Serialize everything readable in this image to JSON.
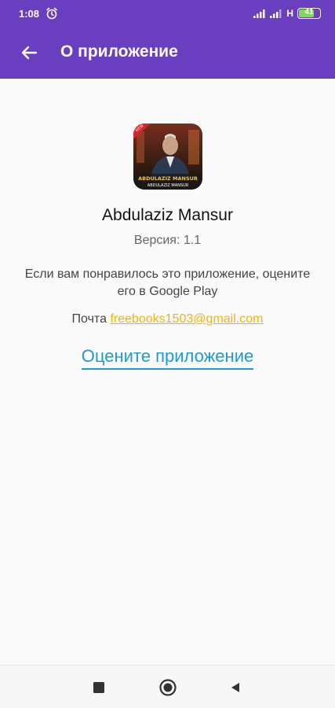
{
  "status_bar": {
    "time": "1:08",
    "network_type": "H",
    "battery_level": "41",
    "icons": [
      "alarm-icon",
      "signal-icon",
      "signal-icon",
      "battery-icon"
    ]
  },
  "app_bar": {
    "title": "О приложение",
    "back_icon": "arrow-left-icon",
    "color": "#6a3fbf"
  },
  "about": {
    "logo_text_line1": "ABDULAZIZ MANSUR",
    "logo_text_line2": "ABDULAZIZ MANSUR",
    "app_name": "Abdulaziz Mansur",
    "version": "Версия: 1.1",
    "rate_message": "Если вам понравилось это приложение, оцените его в Google Play",
    "mail_label": "Почта",
    "mail_address": "freebooks1503@gmail.com",
    "rate_button": "Оцените приложение"
  },
  "colors": {
    "accent_link": "#f3b20e",
    "rate_button": "#1e9bd0"
  },
  "nav_bar": {
    "icons": [
      "recent-apps-icon",
      "home-icon",
      "back-triangle-icon"
    ]
  }
}
